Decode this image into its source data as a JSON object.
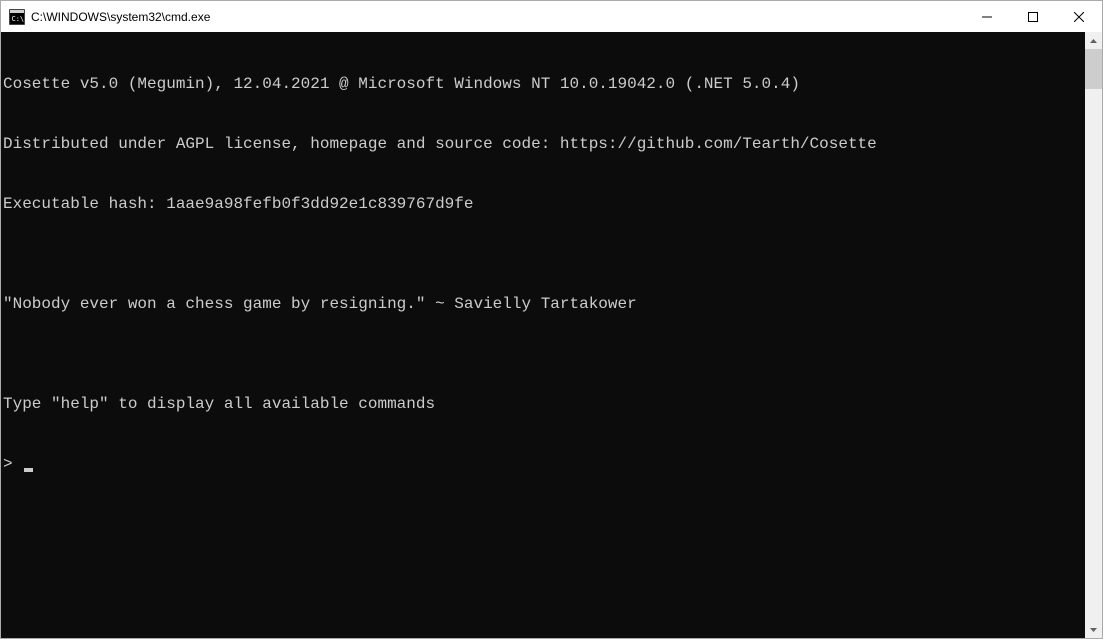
{
  "window": {
    "title": "C:\\WINDOWS\\system32\\cmd.exe"
  },
  "terminal": {
    "lines": [
      "Cosette v5.0 (Megumin), 12.04.2021 @ Microsoft Windows NT 10.0.19042.0 (.NET 5.0.4)",
      "Distributed under AGPL license, homepage and source code: https://github.com/Tearth/Cosette",
      "Executable hash: 1aae9a98fefb0f3dd92e1c839767d9fe",
      "",
      "\"Nobody ever won a chess game by resigning.\" ~ Savielly Tartakower",
      "",
      "Type \"help\" to display all available commands"
    ],
    "prompt": "> "
  }
}
